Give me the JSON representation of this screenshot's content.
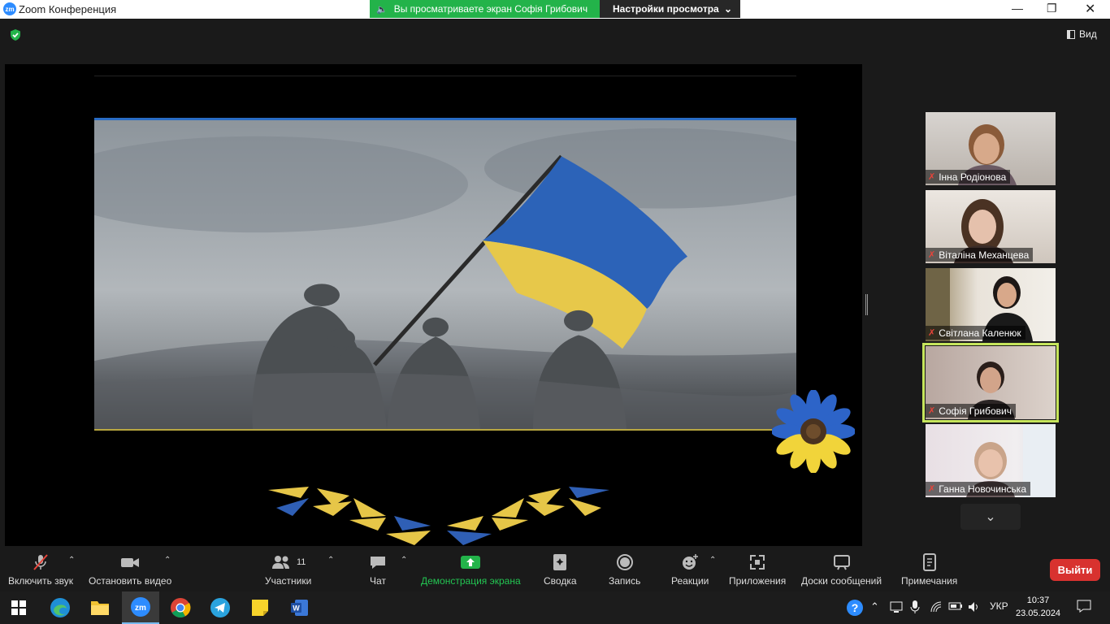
{
  "window": {
    "app_logo": "zm",
    "title": "Zoom Конференция",
    "share_banner": "Вы просматриваете экран Софія Грибович",
    "view_settings": "Настройки просмотра",
    "minimize_icon": "minimize-icon",
    "maximize_icon": "maximize-icon",
    "close_icon": "close-icon"
  },
  "header": {
    "security_icon": "shield-check-icon",
    "view_label": "Вид"
  },
  "colors": {
    "accent_green": "#23b34a",
    "speaker_highlight": "#c6e55c",
    "leave_red": "#d8322f",
    "flag_blue": "#1f5fb0",
    "flag_yellow": "#f2d23a"
  },
  "participants": [
    {
      "name": "Інна Родіонова",
      "muted": true
    },
    {
      "name": "Віталіна Механцева",
      "muted": true
    },
    {
      "name": "Світлана Каленюк",
      "muted": true
    },
    {
      "name": "Софія Грибович",
      "muted": true,
      "active_speaker": true
    },
    {
      "name": "Ганна Новочинська",
      "muted": true
    }
  ],
  "toolbar": {
    "mute_label": "Включить звук",
    "video_label": "Остановить видео",
    "participants_label": "Участники",
    "participants_count": "11",
    "chat_label": "Чат",
    "share_label": "Демонстрация экрана",
    "summary_label": "Сводка",
    "record_label": "Запись",
    "reactions_label": "Реакции",
    "apps_label": "Приложения",
    "whiteboards_label": "Доски сообщений",
    "notes_label": "Примечания",
    "leave_label": "Выйти"
  },
  "taskbar": {
    "apps": [
      "start-icon",
      "edge-icon",
      "file-explorer-icon",
      "zoom-icon",
      "chrome-icon",
      "telegram-icon",
      "sticky-notes-icon",
      "word-icon"
    ],
    "language": "УКР",
    "time": "10:37",
    "date": "23.05.2024"
  }
}
